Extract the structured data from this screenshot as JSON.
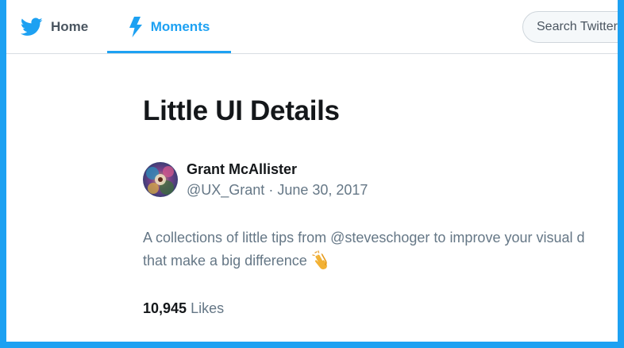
{
  "nav": {
    "home": {
      "label": "Home",
      "icon": "twitter-bird-icon"
    },
    "moments": {
      "label": "Moments",
      "icon": "lightning-bolt-icon",
      "active": true
    },
    "search": {
      "placeholder": "Search Twitter"
    }
  },
  "moment": {
    "title": "Little UI Details",
    "author": {
      "name": "Grant McAllister",
      "handle": "@UX_Grant",
      "separator": "·",
      "date": "June 30, 2017"
    },
    "description": {
      "line1": "A collections of little tips from @steveschoger to improve your visual d",
      "line2": "that make a big difference",
      "emoji": "clapping-hands-icon"
    },
    "likes": {
      "count": "10,945",
      "label": "Likes"
    }
  },
  "colors": {
    "accent": "#1da1f2",
    "text_primary": "#14171a",
    "text_secondary": "#657786",
    "border": "#d8dde2"
  }
}
